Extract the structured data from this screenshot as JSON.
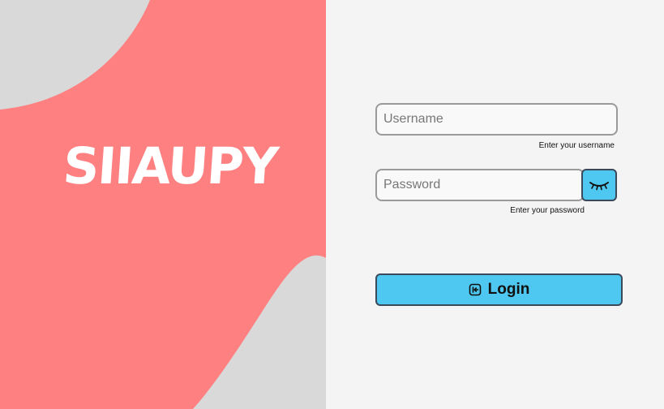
{
  "brand": {
    "logo_text": "SIIAUPY"
  },
  "login_form": {
    "username": {
      "placeholder": "Username",
      "value": "",
      "hint": "Enter your username"
    },
    "password": {
      "placeholder": "Password",
      "value": "",
      "hint": "Enter your password"
    },
    "toggle_icon": "eye-closed-icon",
    "login_button": {
      "label": "Login",
      "icon": "login-icon"
    }
  },
  "colors": {
    "coral": "#ff8080",
    "gray_blob": "#d9d9d9",
    "panel_bg": "#f4f4f4",
    "accent": "#4ec8f0"
  }
}
